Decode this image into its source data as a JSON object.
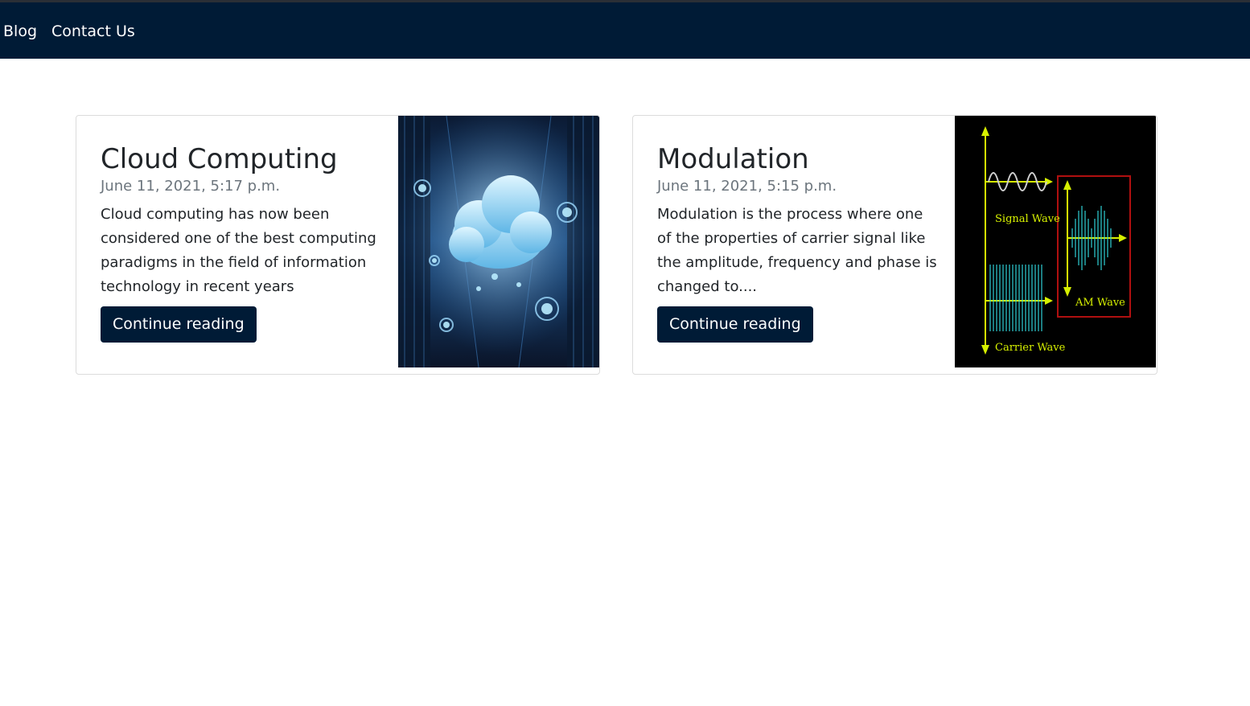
{
  "nav": {
    "items": [
      {
        "label": "Blog"
      },
      {
        "label": "Contact Us"
      }
    ]
  },
  "posts": [
    {
      "title": "Cloud Computing",
      "date": "June 11, 2021, 5:17 p.m.",
      "excerpt_lines": [
        "Cloud computing has now been",
        "considered one of the best computing",
        "paradigms in the field of information",
        "technology in recent years"
      ],
      "button_label": "Continue reading",
      "image_icon": "cloud-datacenter-image"
    },
    {
      "title": "Modulation",
      "date": "June 11, 2021, 5:15 p.m.",
      "excerpt_lines": [
        "Modulation is the process where one",
        "of the properties  of carrier signal like",
        "the amplitude, frequency and phase is",
        "changed to...."
      ],
      "button_label": "Continue reading",
      "image_icon": "am-modulation-diagram-image",
      "image_labels": {
        "signal": "Signal Wave",
        "carrier": "Carrier Wave",
        "am": "AM Wave"
      }
    }
  ],
  "colors": {
    "navbar": "#001b36",
    "button": "#001b36",
    "date": "#6c757d",
    "text": "#212529"
  }
}
